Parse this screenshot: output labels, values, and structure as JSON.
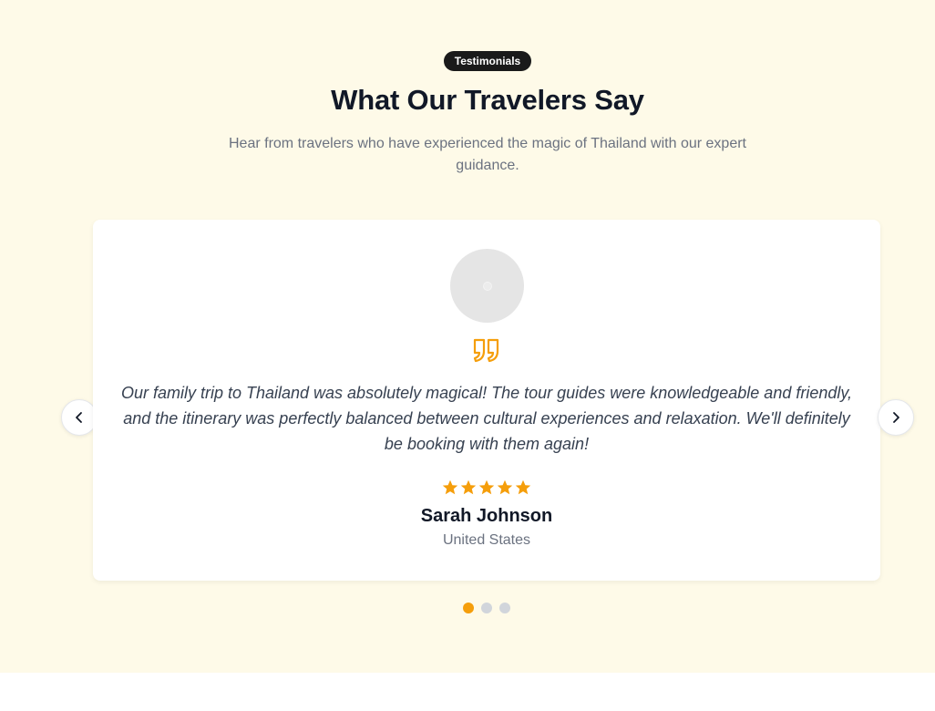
{
  "section": {
    "badge": "Testimonials",
    "title": "What Our Travelers Say",
    "subtitle": "Hear from travelers who have experienced the magic of Thailand with our expert guidance."
  },
  "testimonial": {
    "quote": "Our family trip to Thailand was absolutely magical! The tour guides were knowledgeable and friendly, and the itinerary was perfectly balanced between cultural experiences and relaxation. We'll definitely be booking with them again!",
    "rating": 5,
    "rating_max": 5,
    "name": "Sarah Johnson",
    "location": "United States"
  },
  "carousel": {
    "slide_count": 3,
    "active_index": 0
  },
  "icons": {
    "prev": "chevron-left-icon",
    "next": "chevron-right-icon",
    "quote": "quote-icon",
    "star": "star-icon"
  },
  "colors": {
    "background": "#fefae8",
    "accent": "#f59e0b",
    "badge": "#1a1a1a",
    "card": "#ffffff",
    "dot_inactive": "#d1d5db"
  }
}
